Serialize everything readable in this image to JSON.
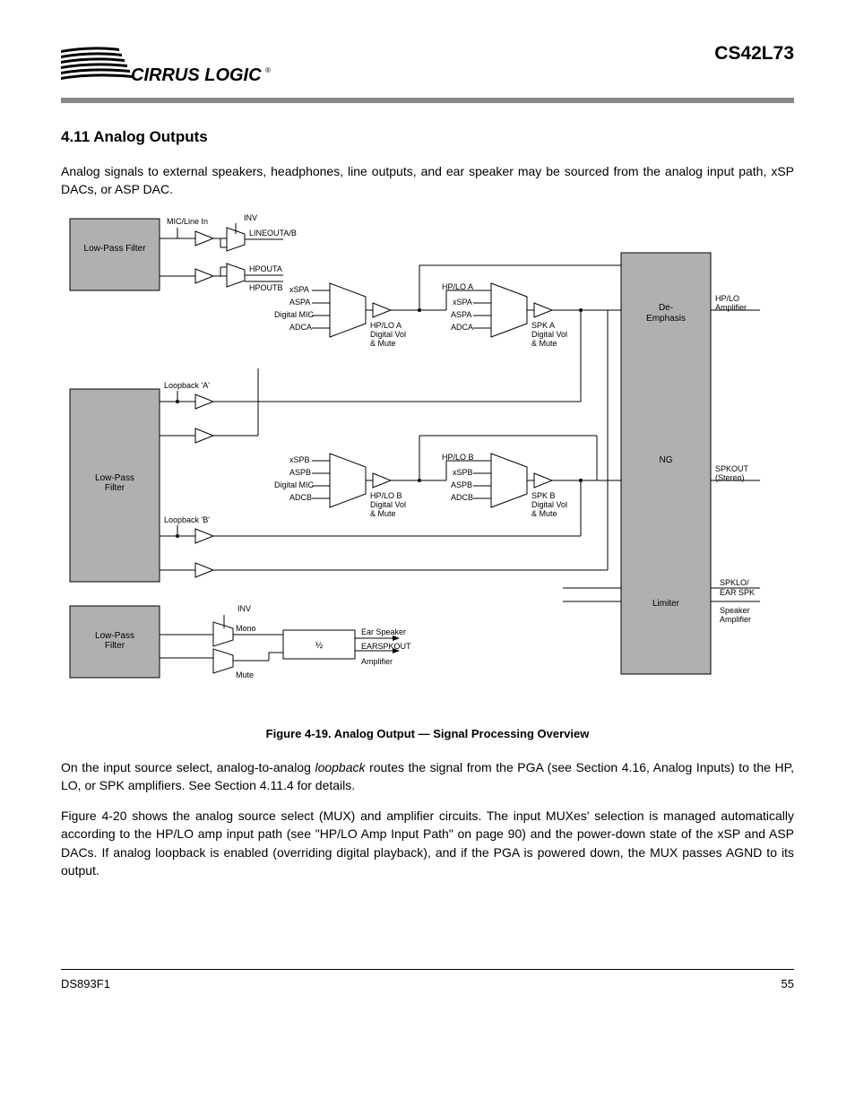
{
  "part_number": "CS42L73",
  "heading": "4.11 Analog Outputs",
  "intro_text": "Analog signals to external speakers, headphones, line outputs, and ear speaker may be sourced from the analog input path, xSP DACs, or ASP DAC.",
  "fig_caption": "Figure 4-19. Analog Output — Signal Processing Overview",
  "para2_a": "On the input source select, analog-to-analog ",
  "para2_i1": "loopback",
  "para2_b": " routes the signal from the PGA (see ",
  "para2_i2": "Section 4.16, Analog Inputs",
  "para2_c": ") to the HP, LO, or SPK amplifiers. See ",
  "para2_i3": "Section 4.11.4 ",
  "para2_d": "for details.",
  "para3_a": "Figure 4-20",
  "para3_b": " shows the analog source select (MUX) and amplifier circuits. The input MUXes' selection is managed automatically according to the HP/LO amp input path (see ",
  "para3_c": "\"HP/LO Amp Input Path\" on page 90",
  "para3_d": ") and the power-down state of the xSP and ASP DACs. If analog loopback is enabled (overriding digital playback), and if the PGA is powered down, the MUX passes AGND to its output.",
  "footer_left": "DS893F1",
  "footer_right": "55",
  "diagram": {
    "low_pass_1": "Low-Pass\nFilter",
    "low_pass_2": "Low-Pass\nFilter",
    "low_pass_3": "Low-Pass\nFilter",
    "mic_line_in": "MIC/Line In",
    "lineoutab": "LINEOUTA/B",
    "hpouta": "HPOUTA",
    "hpoutb": "HPOUTB",
    "inv": "INV",
    "loopback1": "Loopback 'A'",
    "loopback2": "Loopback 'B'",
    "deemph": "De-\nEmphasis",
    "limiter": "Limiter",
    "mux_in": "xSPA\n\nASPA\n\nDigital MIC\n\nADCA",
    "mux2_in": "xSPA\n\nASPA\n\nDigital MIC\n\nADCA",
    "hp_lo_a": "HP/LO A\nDigital Vol\n& Mute",
    "hp_lo_b": "HP/LO B\nDigital Vol\n& Mute",
    "mux_in2": "xSPB\n\nASPB\n\nDigital MIC\n\nADCB",
    "mux_hb_a": "HP/LO A\n\nxSPA\n\nASPA\n\nADCA",
    "spk_a_vol": "SPK A\nDigital Vol\n& Mute",
    "mux_hb_b": "HP/LO B\n\nxSPB\n\nASPB\n\nADCB",
    "spk_b_vol": "SPK B\nDigital Vol\n& Mute",
    "mux2_in2": "xSPB\n\nASPB\n\nDigital MIC\n\nADCB",
    "ng": "NG",
    "hp_lo_amp": "HP/LO\nAmplifier",
    "spk_stereo": "SPKOUT\n(Stereo)",
    "spklo": "SPKLO/\nEAR SPK",
    "spk_amp": "Speaker\nAmplifier",
    "half": "½",
    "ear_spk": "Ear Speaker\nAmplifier",
    "earspkout": "EARSPKOUT",
    "mono": "Mono",
    "mute": "Mute"
  }
}
